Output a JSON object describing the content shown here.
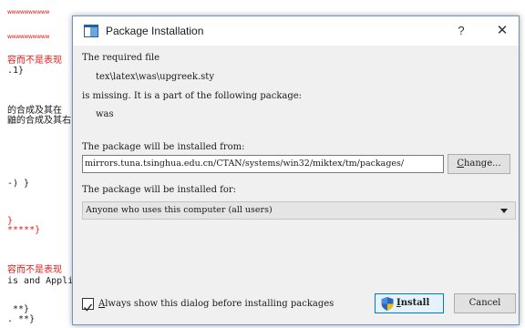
{
  "editor": {
    "line_top_1": "wwwwwwwwww",
    "line_top_2": "wwwwwwwwww",
    "line_red_1": "容而不是表现",
    "line_code_1": ".1}",
    "line_cjk_1": "的合成及其在",
    "line_cjk_2": "鼬的合成及其右",
    "line_code_2": "-) }",
    "line_code_3": "}",
    "line_code_4": "*****}",
    "line_red_2": "容而不是表现",
    "line_code_5": "is and Appli",
    "line_code_6": "**}",
    "line_code_7": ". **}"
  },
  "dialog": {
    "title": "Package Installation",
    "help_label": "?",
    "close_label": "✕",
    "required_label": "The required file",
    "file_path": "tex\\latex\\was\\upgreek.sty",
    "missing_label": "is missing. It is a part of the following package:",
    "package_name": "was",
    "install_from_label": "The package will be installed from:",
    "install_from_value": "mirrors.tuna.tsinghua.edu.cn/CTAN/systems/win32/miktex/tm/packages/",
    "change_first": "C",
    "change_rest": "hange...",
    "install_for_label": "The package will be installed for:",
    "install_for_value": "Anyone who uses this computer (all users)",
    "always_show_first": "A",
    "always_show_rest": "lways show this dialog before installing packages",
    "always_show_checked": "true",
    "install_first": "I",
    "install_rest": "nstall",
    "cancel_label": "Cancel"
  }
}
